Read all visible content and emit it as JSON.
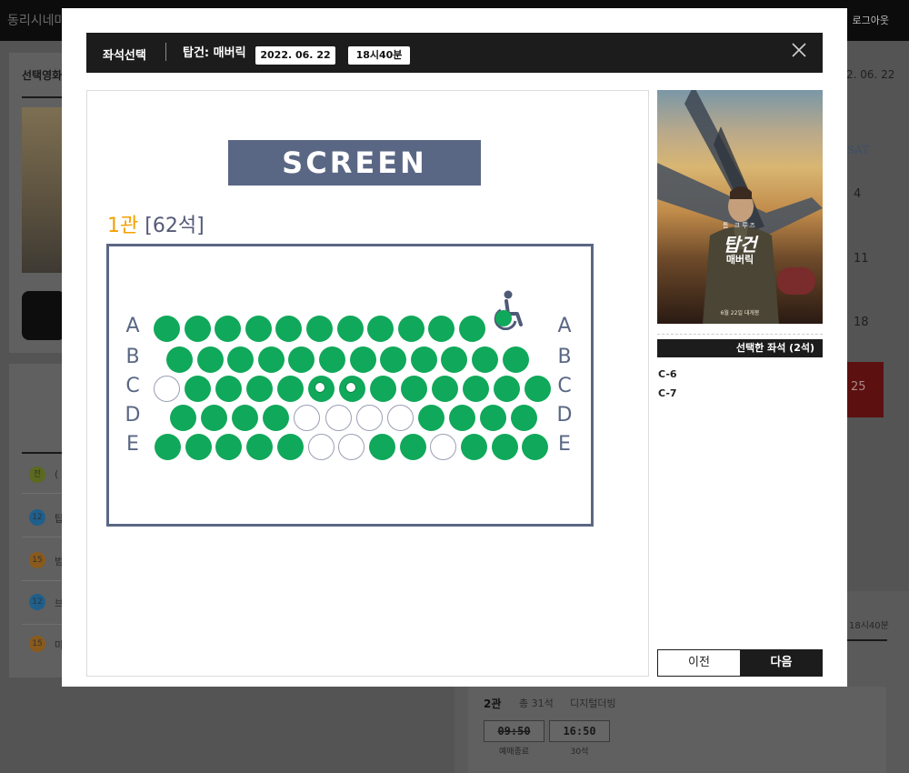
{
  "background": {
    "site_name": "동리시네마",
    "logout": "로그아웃",
    "section_title": "선택영화",
    "ratings": [
      {
        "rating": "전",
        "title": "(",
        "color": "#5b6a1e"
      },
      {
        "rating": "12",
        "title": "탑",
        "color": "#1f5f8c"
      },
      {
        "rating": "15",
        "title": "범",
        "color": "#8a5a1c"
      },
      {
        "rating": "12",
        "title": "브",
        "color": "#1f5f8c"
      },
      {
        "rating": "15",
        "title": "마",
        "color": "#8a5a1c"
      }
    ],
    "date_right": "2. 06. 22",
    "weekday": "SAT",
    "days": [
      "4",
      "11",
      "18",
      "25"
    ],
    "time_right": "18시40분",
    "hall": {
      "name": "2관",
      "total": "총 31석",
      "type": "디지털더빙",
      "times": [
        {
          "time": "09:50",
          "sub": "예매종료",
          "closed": true
        },
        {
          "time": "16:50",
          "sub": "30석",
          "closed": false
        }
      ]
    }
  },
  "modal": {
    "title": "좌석선택",
    "movie": "탑건: 매버릭",
    "date": "2022. 06. 22",
    "time": "18시40분",
    "close_icon": "close-icon",
    "screen_label": "SCREEN",
    "hall_name": "1관",
    "hall_seats": "[62석]",
    "rows": [
      {
        "label": "A",
        "seats": [
          "taken",
          "taken",
          "taken",
          "taken",
          "taken",
          "taken",
          "taken",
          "taken",
          "taken",
          "taken",
          "taken",
          "wheelchair"
        ]
      },
      {
        "label": "B",
        "seats": [
          "taken",
          "taken",
          "taken",
          "taken",
          "taken",
          "taken",
          "taken",
          "taken",
          "taken",
          "taken",
          "taken",
          "taken"
        ]
      },
      {
        "label": "C",
        "seats": [
          "empty",
          "taken",
          "taken",
          "taken",
          "taken",
          "selected",
          "selected",
          "taken",
          "taken",
          "taken",
          "taken",
          "taken",
          "taken"
        ]
      },
      {
        "label": "D",
        "seats": [
          "taken",
          "taken",
          "taken",
          "taken",
          "empty",
          "empty",
          "empty",
          "empty",
          "taken",
          "taken",
          "taken",
          "taken"
        ]
      },
      {
        "label": "E",
        "seats": [
          "taken",
          "taken",
          "taken",
          "taken",
          "taken",
          "empty",
          "empty",
          "taken",
          "taken",
          "empty",
          "taken",
          "taken",
          "taken"
        ]
      }
    ],
    "colors": {
      "taken": "#10a85a",
      "empty": "#ffffff",
      "screen": "#5a6784",
      "hall_number": "#f5a000"
    },
    "poster": {
      "credit": "톰 크루즈",
      "title": "탑건",
      "subtitle": "매버릭",
      "release": "6월 22일 대개봉"
    },
    "selected_header": "선택한 좌석 (2석)",
    "selected_seats": [
      "C-6",
      "C-7"
    ],
    "prev_label": "이전",
    "next_label": "다음"
  }
}
